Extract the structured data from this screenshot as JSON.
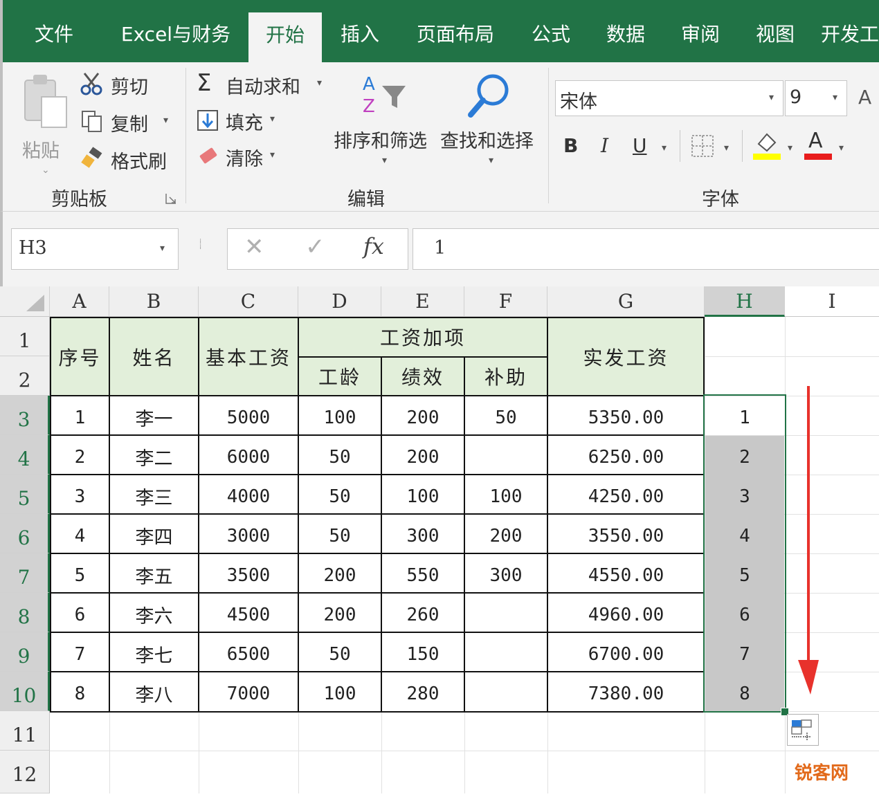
{
  "tabs": [
    "文件",
    "Excel与财务",
    "开始",
    "插入",
    "页面布局",
    "公式",
    "数据",
    "审阅",
    "视图",
    "开发工"
  ],
  "active_tab": "开始",
  "ribbon": {
    "clipboard": {
      "paste": "粘贴",
      "cut": "剪切",
      "copy": "复制",
      "format_painter": "格式刷",
      "group": "剪贴板"
    },
    "editing": {
      "autosum": "自动求和",
      "fill": "填充",
      "clear": "清除",
      "sort_filter": "排序和筛选",
      "find_select": "查找和选择",
      "group": "编辑"
    },
    "font": {
      "font_name": "宋体",
      "font_size": "9",
      "bold": "B",
      "italic": "I",
      "underline": "U",
      "font_color_letter": "A",
      "grow_letter": "A",
      "group": "字体"
    }
  },
  "formula_bar": {
    "name_box": "H3",
    "fx": "fx",
    "value": "1"
  },
  "columns": [
    "A",
    "B",
    "C",
    "D",
    "E",
    "F",
    "G",
    "H",
    "I"
  ],
  "rows": [
    "1",
    "2",
    "3",
    "4",
    "5",
    "6",
    "7",
    "8",
    "9",
    "10",
    "11",
    "12"
  ],
  "table": {
    "headers": {
      "seq": "序号",
      "name": "姓名",
      "base": "基本工资",
      "additions": "工资加项",
      "seniority": "工龄",
      "performance": "绩效",
      "subsidy": "补助",
      "actual": "实发工资"
    },
    "rows": [
      [
        "1",
        "李一",
        "5000",
        "100",
        "200",
        "50",
        "5350.00",
        "1"
      ],
      [
        "2",
        "李二",
        "6000",
        "50",
        "200",
        "",
        "6250.00",
        "2"
      ],
      [
        "3",
        "李三",
        "4000",
        "50",
        "100",
        "100",
        "4250.00",
        "3"
      ],
      [
        "4",
        "李四",
        "3000",
        "50",
        "300",
        "200",
        "3550.00",
        "4"
      ],
      [
        "5",
        "李五",
        "3500",
        "200",
        "550",
        "300",
        "4550.00",
        "5"
      ],
      [
        "6",
        "李六",
        "4500",
        "200",
        "260",
        "",
        "4960.00",
        "6"
      ],
      [
        "7",
        "李七",
        "6500",
        "50",
        "150",
        "",
        "6700.00",
        "7"
      ],
      [
        "8",
        "李八",
        "7000",
        "100",
        "280",
        "",
        "7380.00",
        "8"
      ]
    ]
  },
  "watermark": "锐客网",
  "colors": {
    "excel_green": "#217346",
    "header_fill": "#e2efda",
    "selection_fill": "#c8c8c8",
    "arrow": "#e8322c"
  }
}
